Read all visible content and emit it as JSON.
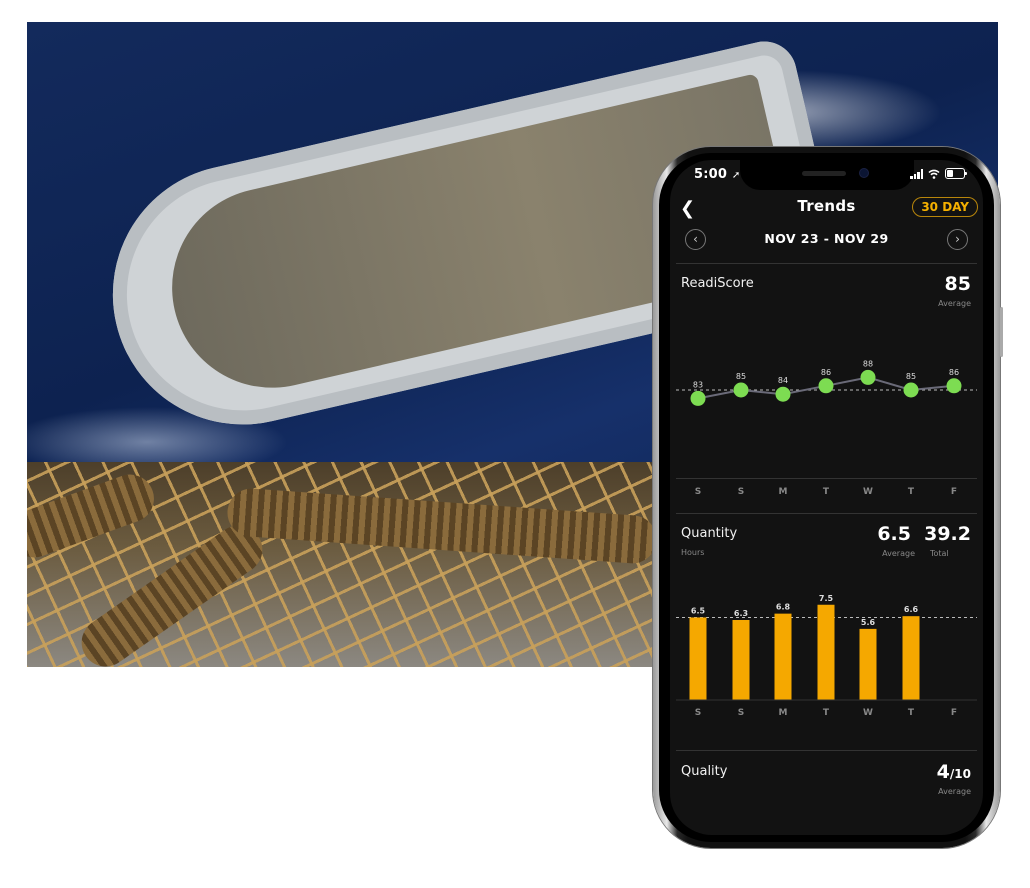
{
  "status_bar": {
    "time": "5:00",
    "location_icon": "location-arrow-icon"
  },
  "header": {
    "back_icon": "chevron-left-icon",
    "title": "Trends",
    "range_button": "30 DAY"
  },
  "date_nav": {
    "prev_icon": "chevron-left-circle-icon",
    "range": "NOV 23 - NOV 29",
    "next_icon": "chevron-right-circle-icon"
  },
  "days": [
    "S",
    "S",
    "M",
    "T",
    "W",
    "T",
    "F"
  ],
  "readiscore": {
    "title": "ReadiScore",
    "average_value": "85",
    "average_label": "Average"
  },
  "quantity": {
    "title": "Quantity",
    "unit": "Hours",
    "average_value": "6.5",
    "average_label": "Average",
    "total_value": "39.2",
    "total_label": "Total"
  },
  "quality": {
    "title": "Quality",
    "value": "4",
    "suffix": "/10",
    "average_label": "Average"
  },
  "colors": {
    "accent": "#f5a800",
    "score_dot": "#7ddc52",
    "background": "#121212"
  },
  "chart_data": [
    {
      "type": "line",
      "title": "ReadiScore",
      "categories": [
        "S",
        "S",
        "M",
        "T",
        "W",
        "T",
        "F"
      ],
      "values": [
        83,
        85,
        84,
        86,
        88,
        85,
        86
      ],
      "reference_line": 85,
      "ylim": [
        70,
        100
      ]
    },
    {
      "type": "bar",
      "title": "Quantity",
      "ylabel": "Hours",
      "categories": [
        "S",
        "S",
        "M",
        "T",
        "W",
        "T",
        "F"
      ],
      "values": [
        6.5,
        6.3,
        6.8,
        7.5,
        5.6,
        6.6,
        null
      ],
      "reference_line": 6.5,
      "ylim": [
        0,
        8.2
      ]
    }
  ]
}
